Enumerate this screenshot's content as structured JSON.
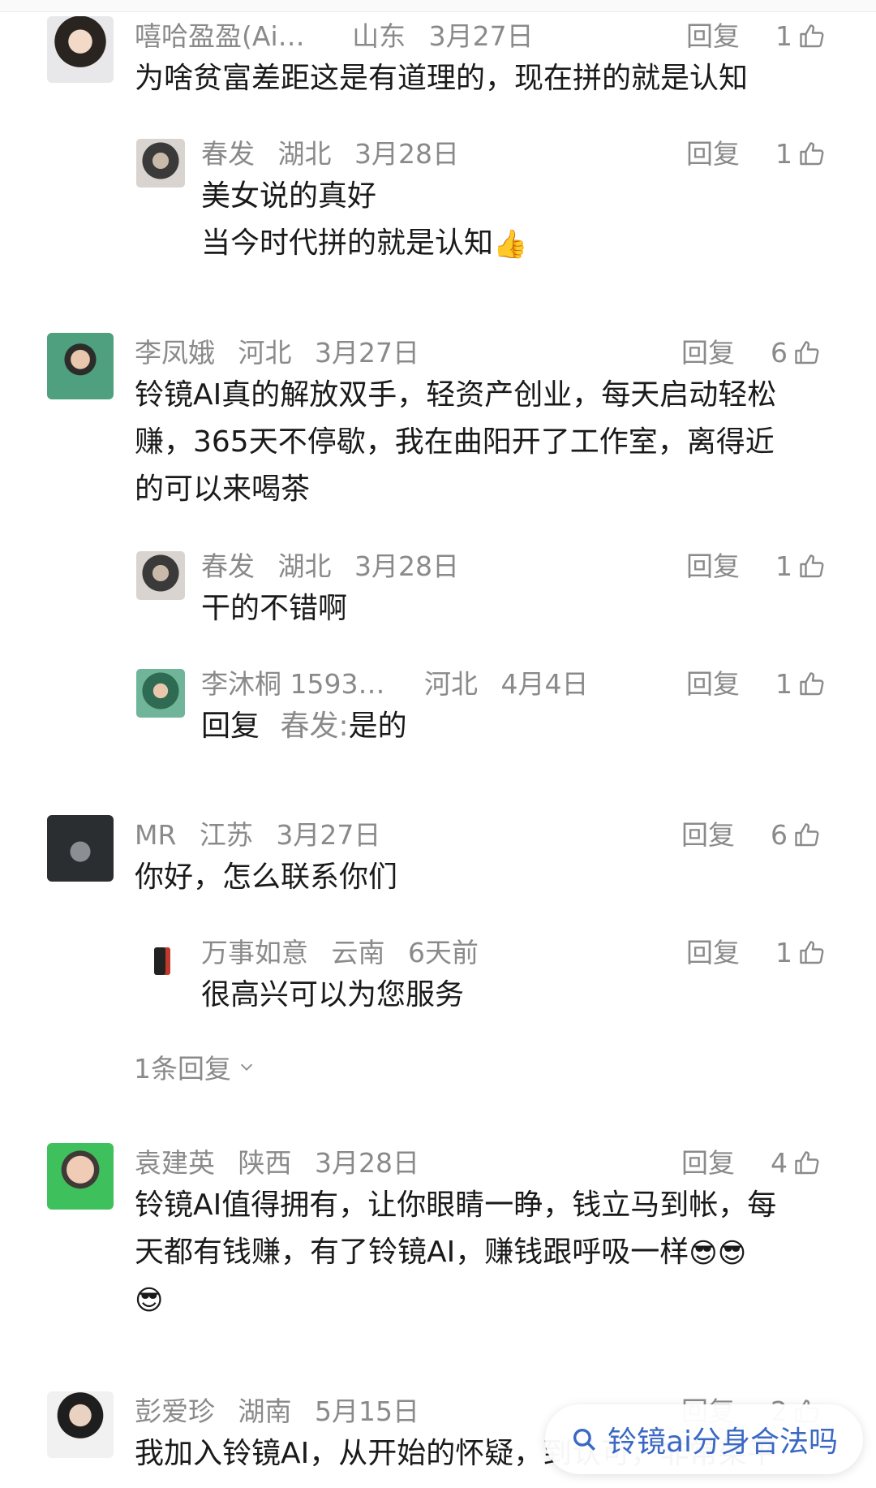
{
  "comments": [
    {
      "name": "嘻哈盈盈(Ai…",
      "region": "山东",
      "date": "3月27日",
      "reply_label": "回复",
      "likes": "1",
      "text": "为啥贫富差距这是有道理的，现在拼的就是认知",
      "replies": [
        {
          "name": "春发",
          "region": "湖北",
          "date": "3月28日",
          "reply_label": "回复",
          "likes": "1",
          "text_line1": "美女说的真好",
          "text_line2": "当今时代拼的就是认知",
          "emoji": "👍"
        }
      ]
    },
    {
      "name": "李凤娥",
      "region": "河北",
      "date": "3月27日",
      "reply_label": "回复",
      "likes": "6",
      "text_line1": "铃镜AI真的解放双手，轻资产创业，每天启动轻松",
      "text_line2": "赚，365天不停歇，我在曲阳开了工作室，离得近",
      "text_line3": "的可以来喝茶",
      "replies": [
        {
          "name": "春发",
          "region": "湖北",
          "date": "3月28日",
          "reply_label": "回复",
          "likes": "1",
          "text": "干的不错啊"
        },
        {
          "name": "李沐桐 1593…",
          "region": "河北",
          "date": "4月4日",
          "reply_label": "回复",
          "likes": "1",
          "text_prefix": "回复",
          "quoted_name": "春发:",
          "text": "是的"
        }
      ]
    },
    {
      "name": "MR",
      "region": "江苏",
      "date": "3月27日",
      "reply_label": "回复",
      "likes": "6",
      "text": "你好，怎么联系你们",
      "replies": [
        {
          "name": "万事如意",
          "region": "云南",
          "date": "6天前",
          "reply_label": "回复",
          "likes": "1",
          "text": "很高兴可以为您服务"
        }
      ],
      "more_replies": "1条回复"
    },
    {
      "name": "袁建英",
      "region": "陕西",
      "date": "3月28日",
      "reply_label": "回复",
      "likes": "4",
      "text_line1": "铃镜AI值得拥有，让你眼睛一睁，钱立马到帐，每",
      "text_line2": "天都有钱赚，有了铃镜AI，赚钱跟呼吸一样",
      "emoji": "😎"
    },
    {
      "name": "彭爱珍",
      "region": "湖南",
      "date": "5月15日",
      "reply_label": "回复",
      "likes": "2",
      "text": "我加入铃镜AI，从开始的怀疑，到认可，非常架平"
    }
  ],
  "search": {
    "label": "铃镜ai分身合法吗"
  },
  "colors": {
    "meta_gray": "#8a8a8a",
    "text": "#1a1a1a",
    "search_blue": "#3a68c4"
  }
}
